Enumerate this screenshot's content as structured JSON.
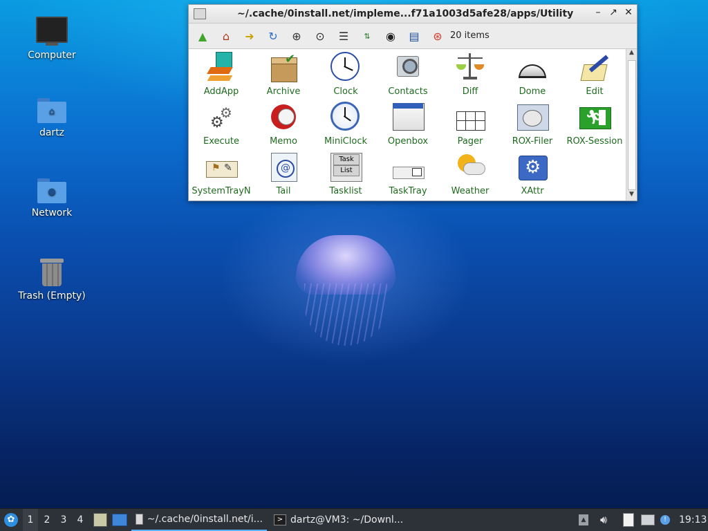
{
  "desktop": {
    "icons": [
      {
        "label": "Computer"
      },
      {
        "label": "dartz"
      },
      {
        "label": "Network"
      },
      {
        "label": "Trash (Empty)"
      }
    ]
  },
  "window": {
    "title": "~/.cache/0install.net/impleme...f71a1003d5afe28/apps/Utility",
    "controls": {
      "minimize": "–",
      "restore": "↗",
      "close": "✕"
    },
    "item_count": "20 items",
    "items": [
      {
        "label": "AddApp"
      },
      {
        "label": "Archive"
      },
      {
        "label": "Clock"
      },
      {
        "label": "Contacts"
      },
      {
        "label": "Diff"
      },
      {
        "label": "Dome"
      },
      {
        "label": "Edit"
      },
      {
        "label": "Execute"
      },
      {
        "label": "Memo"
      },
      {
        "label": "MiniClock"
      },
      {
        "label": "Openbox"
      },
      {
        "label": "Pager"
      },
      {
        "label": "ROX-Filer"
      },
      {
        "label": "ROX-Session"
      },
      {
        "label": "SystemTrayN"
      },
      {
        "label": "Tail"
      },
      {
        "label": "Tasklist"
      },
      {
        "label": "TaskTray"
      },
      {
        "label": "Weather"
      },
      {
        "label": "XAttr"
      }
    ],
    "tasklist_icon": {
      "line1": "Task",
      "line2": "List"
    }
  },
  "taskbar": {
    "workspaces": [
      "1",
      "2",
      "3",
      "4"
    ],
    "tasks": [
      {
        "label": "~/.cache/0install.net/i..."
      },
      {
        "label": "dartz@VM3: ~/Downl..."
      }
    ],
    "clock": "19:13"
  }
}
